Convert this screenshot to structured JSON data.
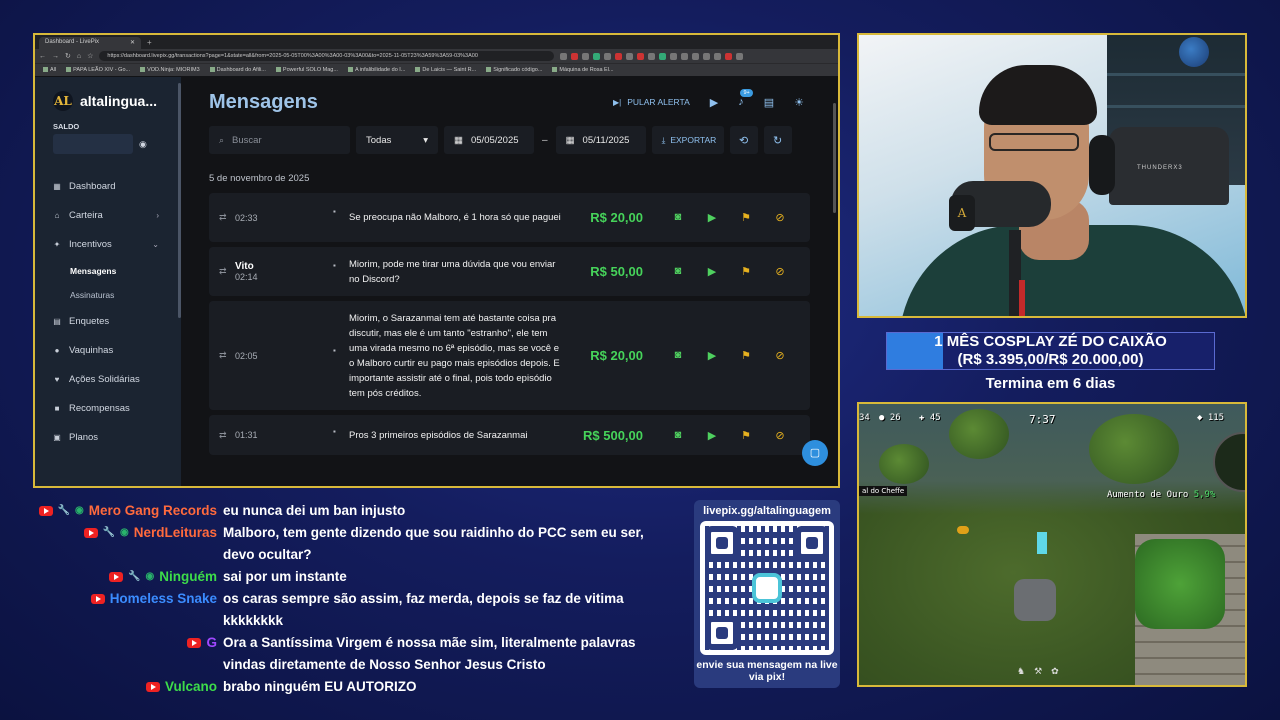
{
  "browser": {
    "tab_title": "Dashboard - LivePix",
    "url": "https://dashboard.livepix.gg/transactions?page=1&state=all&from=2025-05-05T00%3A00%3A00-03%3A00&to=2025-11-05T23%3A59%3A59-03%3A00",
    "bookmarks": [
      "All",
      "PAPA LEÃO XIV - Go...",
      "VOD.Ninja: MIORIM3",
      "Dashboard do Afili...",
      "Powerful SOLO Mag...",
      "A infalibilidade do I...",
      "De Laicis — Saint R...",
      "Significado código...",
      "Máquina de Rosa El..."
    ]
  },
  "sidebar": {
    "brand": "altalingua...",
    "saldo_label": "SALDO",
    "items": [
      {
        "label": "Dashboard",
        "icon": "dashboard-icon"
      },
      {
        "label": "Carteira",
        "icon": "bank-icon"
      },
      {
        "label": "Incentivos",
        "icon": "sparkle-icon"
      },
      {
        "label": "Enquetes",
        "icon": "poll-icon"
      },
      {
        "label": "Vaquinhas",
        "icon": "piggy-icon"
      },
      {
        "label": "Ações Solidárias",
        "icon": "heart-icon"
      },
      {
        "label": "Recompensas",
        "icon": "gift-icon"
      },
      {
        "label": "Planos",
        "icon": "plans-icon"
      }
    ],
    "subitems": [
      "Mensagens",
      "Assinaturas"
    ]
  },
  "main": {
    "title": "Mensagens",
    "pular_alerta": "PULAR ALERTA",
    "notification_badge": "9+",
    "search_placeholder": "Buscar",
    "filter_select": "Todas",
    "date_from": "05/05/2025",
    "date_to": "05/11/2025",
    "date_separator": "–",
    "export_label": "EXPORTAR",
    "date_heading": "5 de novembro de 2025",
    "rows": [
      {
        "name": "",
        "time": "02:33",
        "message": "Se preocupa não Malboro, é 1 hora só que paguei",
        "amount": "R$ 20,00"
      },
      {
        "name": "Vito",
        "time": "02:14",
        "message": "Miorim, pode me tirar uma dúvida que vou enviar no Discord?",
        "amount": "R$ 50,00"
      },
      {
        "name": "",
        "time": "02:05",
        "message": "Miorim, o Sarazanmai tem até bastante coisa pra discutir, mas ele é um tanto \"estranho\", ele tem uma virada mesmo no 6ª episódio, mas se você e o Malboro curtir eu pago mais episódios depois. E importante assistir até o final, pois todo episódio tem pós créditos.",
        "amount": "R$ 20,00"
      },
      {
        "name": "",
        "time": "01:31",
        "message": "Pros 3 primeiros episódios de Sarazanmai",
        "amount": "R$ 500,00"
      }
    ]
  },
  "goal": {
    "line1": "1 MÊS COSPLAY ZÉ DO CAIXÃO",
    "line2": "(R$ 3.395,00/R$ 20.000,00)",
    "progress": 0.17,
    "ends": "Termina em 6 dias"
  },
  "webcam": {
    "chair_brand": "THUNDERX3"
  },
  "game": {
    "timer": "7:37",
    "hud_left": "34",
    "hud_a": "26",
    "hud_b": "45",
    "hud_right": "115",
    "boss_tag": "al do Cheffe",
    "buff_name": "Aumento de Ouro",
    "buff_value": "5,9%"
  },
  "chat": [
    {
      "author": "Mero Gang Records",
      "color": "#ff6a3d",
      "badges": [
        "yt",
        "mod",
        "vip"
      ],
      "text": "eu nunca dei um ban injusto"
    },
    {
      "author": "NerdLeituras",
      "color": "#ff6a3d",
      "badges": [
        "yt",
        "mod",
        "vip"
      ],
      "text": "Malboro, tem gente dizendo que sou raidinho do PCC sem eu ser, devo ocultar?"
    },
    {
      "author": "Ninguém",
      "color": "#3ddc4a",
      "badges": [
        "yt",
        "mod",
        "vip"
      ],
      "text": "sai por um instante"
    },
    {
      "author": "Homeless Snake",
      "color": "#3b8cff",
      "badges": [
        "yt"
      ],
      "text": "os caras sempre são assim, faz merda, depois se faz de vitima kkkkkkkk"
    },
    {
      "author": "G",
      "color": "#a048ff",
      "badges": [
        "yt"
      ],
      "text": "Ora a Santíssima Virgem é nossa mãe sim, literalmente palavras vindas diretamente de Nosso Senhor Jesus Cristo"
    },
    {
      "author": "Vulcano",
      "color": "#3ddc4a",
      "badges": [
        "yt"
      ],
      "text": "brabo ninguém EU AUTORIZO"
    }
  ],
  "qr": {
    "url": "livepix.gg/altalinguagem",
    "cta": "envie sua mensagem na live via pix!"
  }
}
